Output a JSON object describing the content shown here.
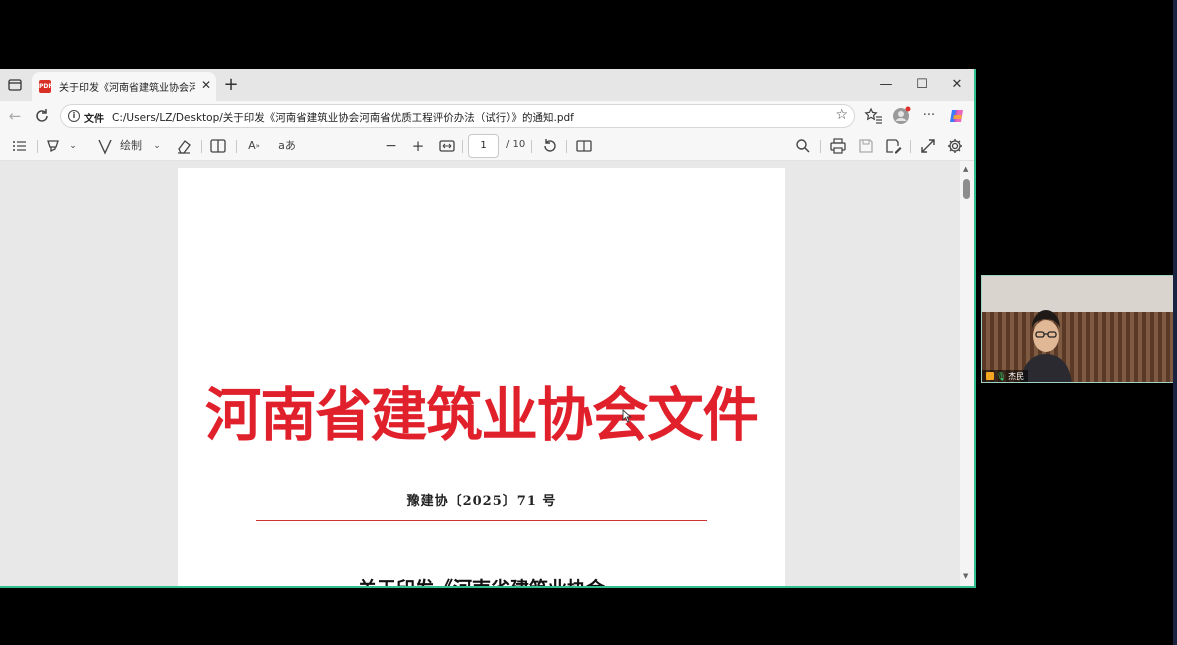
{
  "browser": {
    "tab": {
      "title": "关于印发《河南省建筑业协会河南省优质工程评价办法（试行）》的通知.pdf",
      "close_glyph": "✕",
      "icon_label": "PDF"
    },
    "new_tab_glyph": "+",
    "window_controls": {
      "minimize": "—",
      "maximize": "☐",
      "close": "✕"
    },
    "address": {
      "scheme_label": "文件",
      "url": "C:/Users/LZ/Desktop/关于印发《河南省建筑业协会河南省优质工程评价办法（试行）》的通知.pdf"
    }
  },
  "pdf_toolbar": {
    "draw_label": "绘制",
    "page_current": "1",
    "page_total": "/ 10"
  },
  "document": {
    "header": "河南省建筑业协会文件",
    "doc_number": "豫建协〔2025〕71 号",
    "title_partial": "关于印发《河南省建筑业协会"
  },
  "video": {
    "participant_name": "杰民"
  },
  "colors": {
    "header_red": "#e0202b",
    "accent_border": "#2fbf8f"
  }
}
